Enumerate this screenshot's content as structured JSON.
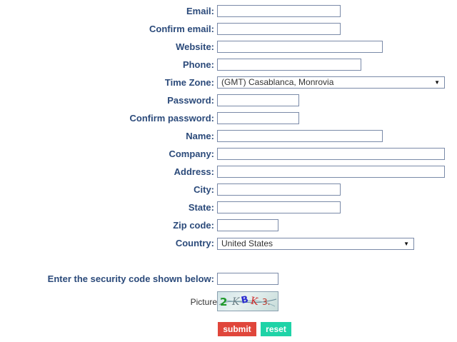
{
  "form": {
    "email_label": "Email:",
    "confirm_email_label": "Confirm email:",
    "website_label": "Website:",
    "phone_label": "Phone:",
    "timezone_label": "Time Zone:",
    "timezone_value": "(GMT) Casablanca, Monrovia",
    "password_label": "Password:",
    "confirm_password_label": "Confirm password:",
    "name_label": "Name:",
    "company_label": "Company:",
    "address_label": "Address:",
    "city_label": "City:",
    "state_label": "State:",
    "zip_label": "Zip code:",
    "country_label": "Country:",
    "country_value": "United States",
    "security_label": "Enter the security code shown below:",
    "picture_label": "Picture",
    "submit_label": "submit",
    "reset_label": "reset"
  },
  "captcha": {
    "text": "2KBK3"
  },
  "colors": {
    "label": "#2b4a7a",
    "submit_bg": "#e0463b",
    "reset_bg": "#1fd3a7"
  }
}
